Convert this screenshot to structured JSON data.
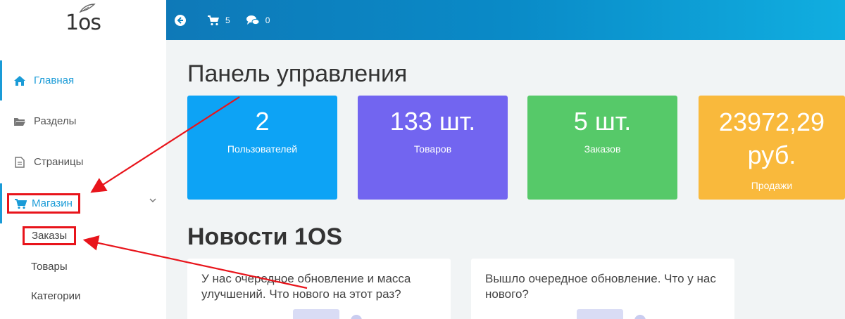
{
  "logo": {
    "text": "1os"
  },
  "sidebar": {
    "items": [
      {
        "label": "Главная",
        "icon": "home-icon"
      },
      {
        "label": "Разделы",
        "icon": "folder-icon"
      },
      {
        "label": "Страницы",
        "icon": "file-icon"
      },
      {
        "label": "Магазин",
        "icon": "cart-icon"
      }
    ],
    "subitems": [
      {
        "label": "Заказы"
      },
      {
        "label": "Товары"
      },
      {
        "label": "Категории"
      }
    ]
  },
  "topbar": {
    "cart_count": "5",
    "comments_count": "0"
  },
  "main": {
    "title": "Панель управления",
    "news_title": "Новости 1OS",
    "cards": [
      {
        "value": "2",
        "label": "Пользователей",
        "color": "#0da3f5"
      },
      {
        "value": "133 шт.",
        "label": "Товаров",
        "color": "#7265f0"
      },
      {
        "value": "5 шт.",
        "label": "Заказов",
        "color": "#56c969"
      },
      {
        "value": "23972,29",
        "value2": "руб.",
        "label": "Продажи",
        "color": "#f9b93c"
      }
    ],
    "news": [
      {
        "text": "У нас очередное обновление и масса улучшений. Что нового на этот раз?"
      },
      {
        "text": "Вышло очередное обновление. Что у нас нового?"
      }
    ]
  },
  "colors": {
    "accent": "#1a9bd7",
    "highlight": "#e8141b"
  }
}
